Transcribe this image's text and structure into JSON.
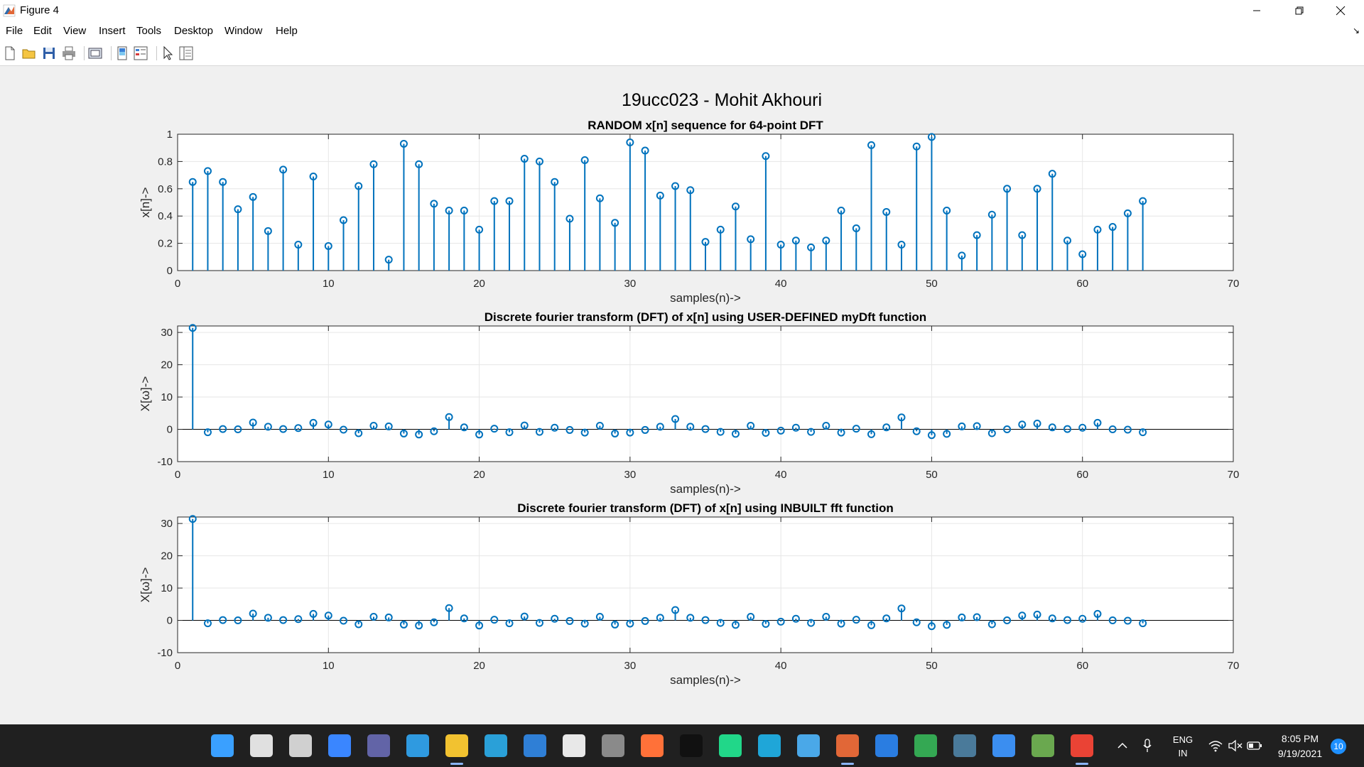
{
  "window": {
    "title": "Figure 4"
  },
  "menu": [
    "File",
    "Edit",
    "View",
    "Insert",
    "Tools",
    "Desktop",
    "Window",
    "Help"
  ],
  "toolbar_icons": [
    "new-figure-icon",
    "open-file-icon",
    "save-icon",
    "print-icon",
    "print-preview-icon",
    "colorbar-icon",
    "legend-icon",
    "pointer-icon",
    "property-editor-icon"
  ],
  "figure": {
    "suptitle": "19ucc023 - Mohit Akhouri"
  },
  "chart_data": [
    {
      "type": "stem",
      "title": "RANDOM x[n] sequence for 64-point DFT",
      "xlabel": "samples(n)->",
      "ylabel": "x[n]->",
      "xlim": [
        0,
        70
      ],
      "ylim": [
        0,
        1
      ],
      "xticks": [
        0,
        10,
        20,
        30,
        40,
        50,
        60,
        70
      ],
      "yticks": [
        0,
        0.2,
        0.4,
        0.6,
        0.8,
        1
      ],
      "grid": true,
      "color": "#0072bd",
      "x": [
        1,
        2,
        3,
        4,
        5,
        6,
        7,
        8,
        9,
        10,
        11,
        12,
        13,
        14,
        15,
        16,
        17,
        18,
        19,
        20,
        21,
        22,
        23,
        24,
        25,
        26,
        27,
        28,
        29,
        30,
        31,
        32,
        33,
        34,
        35,
        36,
        37,
        38,
        39,
        40,
        41,
        42,
        43,
        44,
        45,
        46,
        47,
        48,
        49,
        50,
        51,
        52,
        53,
        54,
        55,
        56,
        57,
        58,
        59,
        60,
        61,
        62,
        63,
        64
      ],
      "y": [
        0.65,
        0.73,
        0.65,
        0.45,
        0.54,
        0.29,
        0.74,
        0.19,
        0.69,
        0.18,
        0.37,
        0.62,
        0.78,
        0.08,
        0.93,
        0.78,
        0.49,
        0.44,
        0.44,
        0.3,
        0.51,
        0.51,
        0.82,
        0.8,
        0.65,
        0.38,
        0.81,
        0.53,
        0.35,
        0.94,
        0.88,
        0.55,
        0.62,
        0.59,
        0.21,
        0.3,
        0.47,
        0.23,
        0.84,
        0.19,
        0.22,
        0.17,
        0.22,
        0.44,
        0.31,
        0.92,
        0.43,
        0.19,
        0.91,
        0.98,
        0.44,
        0.11,
        0.26,
        0.41,
        0.6,
        0.26,
        0.6,
        0.71,
        0.22,
        0.12,
        0.3,
        0.32,
        0.42,
        0.51
      ]
    },
    {
      "type": "stem",
      "title": "Discrete fourier transform (DFT) of x[n] using USER-DEFINED myDft function",
      "xlabel": "samples(n)->",
      "ylabel": "X[ω]->",
      "xlim": [
        0,
        70
      ],
      "ylim": [
        -10,
        32
      ],
      "xticks": [
        0,
        10,
        20,
        30,
        40,
        50,
        60,
        70
      ],
      "yticks": [
        -10,
        0,
        10,
        20,
        30
      ],
      "grid": true,
      "color": "#0072bd",
      "x": [
        1,
        2,
        3,
        4,
        5,
        6,
        7,
        8,
        9,
        10,
        11,
        12,
        13,
        14,
        15,
        16,
        17,
        18,
        19,
        20,
        21,
        22,
        23,
        24,
        25,
        26,
        27,
        28,
        29,
        30,
        31,
        32,
        33,
        34,
        35,
        36,
        37,
        38,
        39,
        40,
        41,
        42,
        43,
        44,
        45,
        46,
        47,
        48,
        49,
        50,
        51,
        52,
        53,
        54,
        55,
        56,
        57,
        58,
        59,
        60,
        61,
        62,
        63,
        64
      ],
      "y": [
        31.4,
        -0.9,
        0.1,
        0,
        2.1,
        0.8,
        0.1,
        0.4,
        2.0,
        1.5,
        -0.1,
        -1.2,
        1.1,
        0.9,
        -1.3,
        -1.6,
        -0.6,
        3.8,
        0.6,
        -1.6,
        0.2,
        -0.9,
        1.2,
        -0.8,
        0.5,
        -0.2,
        -1.0,
        1.1,
        -1.3,
        -1.0,
        -0.2,
        0.8,
        3.2,
        0.8,
        0.1,
        -0.8,
        -1.4,
        1.1,
        -1.1,
        -0.4,
        0.5,
        -0.8,
        1.1,
        -1.0,
        0.2,
        -1.5,
        0.6,
        3.7,
        -0.6,
        -1.8,
        -1.4,
        0.9,
        1.0,
        -1.2,
        0,
        1.5,
        1.8,
        0.6,
        0.1,
        0.5,
        2.0,
        0,
        -0.1,
        -0.9
      ]
    },
    {
      "type": "stem",
      "title": "Discrete fourier transform (DFT) of x[n] using INBUILT fft function",
      "xlabel": "samples(n)->",
      "ylabel": "X[ω]->",
      "xlim": [
        0,
        70
      ],
      "ylim": [
        -10,
        32
      ],
      "xticks": [
        0,
        10,
        20,
        30,
        40,
        50,
        60,
        70
      ],
      "yticks": [
        -10,
        0,
        10,
        20,
        30
      ],
      "grid": true,
      "color": "#0072bd",
      "x": [
        1,
        2,
        3,
        4,
        5,
        6,
        7,
        8,
        9,
        10,
        11,
        12,
        13,
        14,
        15,
        16,
        17,
        18,
        19,
        20,
        21,
        22,
        23,
        24,
        25,
        26,
        27,
        28,
        29,
        30,
        31,
        32,
        33,
        34,
        35,
        36,
        37,
        38,
        39,
        40,
        41,
        42,
        43,
        44,
        45,
        46,
        47,
        48,
        49,
        50,
        51,
        52,
        53,
        54,
        55,
        56,
        57,
        58,
        59,
        60,
        61,
        62,
        63,
        64
      ],
      "y": [
        31.4,
        -0.9,
        0.1,
        0,
        2.1,
        0.8,
        0.1,
        0.4,
        2.0,
        1.5,
        -0.1,
        -1.2,
        1.1,
        0.9,
        -1.3,
        -1.6,
        -0.6,
        3.8,
        0.6,
        -1.6,
        0.2,
        -0.9,
        1.2,
        -0.8,
        0.5,
        -0.2,
        -1.0,
        1.1,
        -1.3,
        -1.0,
        -0.2,
        0.8,
        3.2,
        0.8,
        0.1,
        -0.8,
        -1.4,
        1.1,
        -1.1,
        -0.4,
        0.5,
        -0.8,
        1.1,
        -1.0,
        0.2,
        -1.5,
        0.6,
        3.7,
        -0.6,
        -1.8,
        -1.4,
        0.9,
        1.0,
        -1.2,
        0,
        1.5,
        1.8,
        0.6,
        0.1,
        0.5,
        2.0,
        0,
        -0.1,
        -0.9
      ]
    }
  ],
  "taskbar": {
    "icons": [
      {
        "name": "start-icon",
        "color": "#3aa0ff"
      },
      {
        "name": "search-icon",
        "color": "#e0e0e0"
      },
      {
        "name": "task-view-icon",
        "color": "#d0d0d0"
      },
      {
        "name": "widgets-icon",
        "color": "#3a86ff"
      },
      {
        "name": "teams-chat-icon",
        "color": "#6264a7"
      },
      {
        "name": "vscode-icon",
        "color": "#2f9ae0"
      },
      {
        "name": "file-explorer-icon",
        "color": "#f2c230"
      },
      {
        "name": "desktop-icon",
        "color": "#2aa0d8"
      },
      {
        "name": "microsoft-store-icon",
        "color": "#2f7fd6"
      },
      {
        "name": "dropbox-icon",
        "color": "#e8e8e8"
      },
      {
        "name": "calculator-icon",
        "color": "#8a8a8a"
      },
      {
        "name": "firefox-icon",
        "color": "#ff7139"
      },
      {
        "name": "terminal-icon",
        "color": "#111111"
      },
      {
        "name": "pycharm-icon",
        "color": "#21d789"
      },
      {
        "name": "edge-icon",
        "color": "#1fa6d8"
      },
      {
        "name": "notepad-icon",
        "color": "#4aa8e8"
      },
      {
        "name": "matlab-icon",
        "color": "#e16737"
      },
      {
        "name": "bing-icon",
        "color": "#2a7de1"
      },
      {
        "name": "chrome-icon",
        "color": "#34a853"
      },
      {
        "name": "vmware-icon",
        "color": "#4a7a9a"
      },
      {
        "name": "todo-icon",
        "color": "#3b8ef0"
      },
      {
        "name": "paint-icon",
        "color": "#6aa84f"
      },
      {
        "name": "chrome-profile-icon",
        "color": "#ea4335"
      }
    ],
    "tray": {
      "lang_top": "ENG",
      "lang_bottom": "IN",
      "time": "8:05 PM",
      "date": "9/19/2021",
      "notifications": "10"
    }
  }
}
